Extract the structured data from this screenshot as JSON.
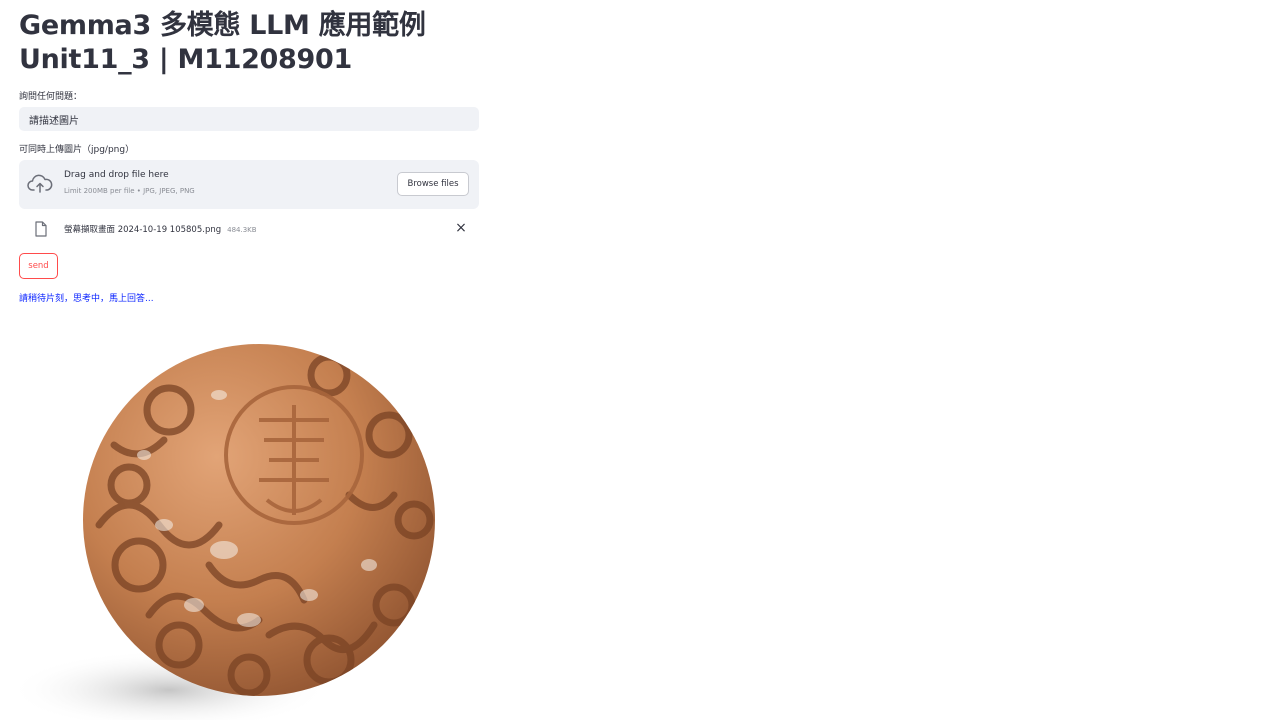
{
  "title": {
    "line1": "Gemma3 多模態 LLM 應用範例",
    "line2": "Unit11_3 | M11208901"
  },
  "question": {
    "label": "詢問任何問題：",
    "value": "請描述圖片"
  },
  "uploader": {
    "label": "可同時上傳圖片（jpg/png）",
    "dropzone_title": "Drag and drop file here",
    "dropzone_limit": "Limit 200MB per file • JPG, JPEG, PNG",
    "browse_label": "Browse files",
    "upload_icon": "cloud-upload-icon"
  },
  "file": {
    "name": "螢幕擷取畫面 2024-10-19 105805.png",
    "size": "484.3KB",
    "icon": "file-icon",
    "close": "×"
  },
  "send_label": "send",
  "status_text": "請稍待片刻，思考中，馬上回答...",
  "colors": {
    "primary": "#ff4b4b",
    "status": "#0b24ff",
    "input_bg": "#f0f2f6",
    "text": "#31333f",
    "ball": "#c47f4f"
  },
  "image": {
    "subject": "carved terracotta openwork ball"
  }
}
